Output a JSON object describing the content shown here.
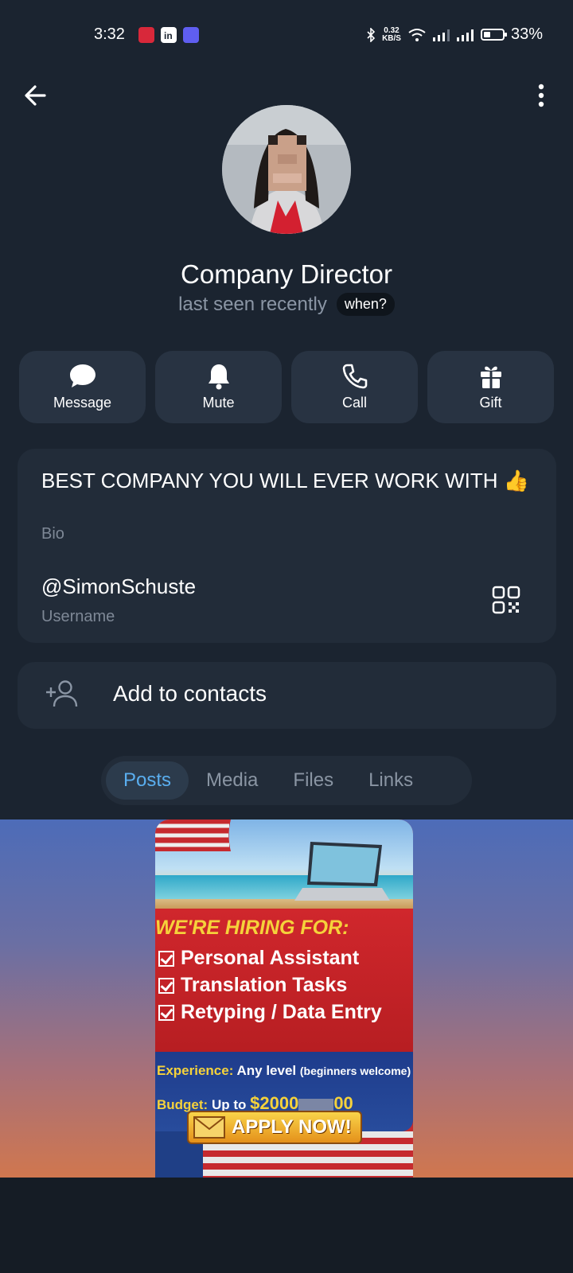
{
  "status_bar": {
    "time": "3:32",
    "speed_value": "0.32",
    "speed_unit": "KB/S",
    "battery": "33%"
  },
  "profile": {
    "name": "Company Director",
    "last_seen": "last seen recently",
    "when_label": "when?"
  },
  "actions": [
    {
      "label": "Message",
      "icon": "message-icon"
    },
    {
      "label": "Mute",
      "icon": "bell-icon"
    },
    {
      "label": "Call",
      "icon": "phone-icon"
    },
    {
      "label": "Gift",
      "icon": "gift-icon"
    }
  ],
  "info": {
    "bio": "BEST COMPANY YOU WILL EVER WORK WITH 👍",
    "bio_label": "Bio",
    "username": "@SimonSchuste",
    "username_label": "Username"
  },
  "add_contact": {
    "label": "Add to contacts"
  },
  "tabs": [
    {
      "label": "Posts",
      "active": true
    },
    {
      "label": "Media",
      "active": false
    },
    {
      "label": "Files",
      "active": false
    },
    {
      "label": "Links",
      "active": false
    }
  ],
  "post": {
    "hiring_title": "WE'RE HIRING FOR:",
    "items": [
      "Personal Assistant",
      "Translation Tasks",
      "Retyping / Data Entry"
    ],
    "experience_key": "Experience:",
    "experience_value": "Any level",
    "experience_note": "(beginners welcome)",
    "budget_key": "Budget:",
    "budget_prefix": "Up to",
    "budget_value": "$2000",
    "budget_suffix": "00",
    "apply_label": "APPLY NOW!"
  },
  "colors": {
    "background": "#151c25",
    "header_bg": "#1b2430",
    "card_bg": "#222c39",
    "button_bg": "#283342",
    "accent_tab": "#5aaeef",
    "muted_text": "#8b96a5"
  }
}
